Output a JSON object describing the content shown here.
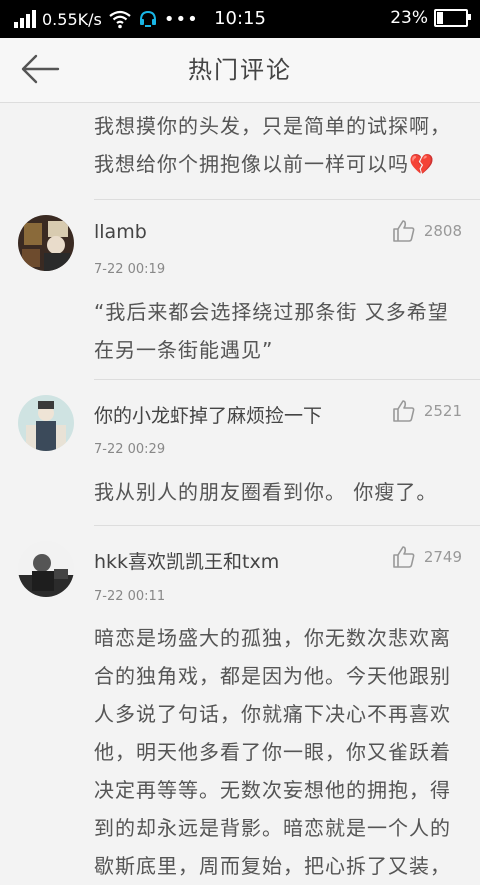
{
  "status_bar": {
    "network_speed": "0.55K/s",
    "time": "10:15",
    "battery": "23%",
    "battery_level": 0.23
  },
  "header": {
    "title": "热门评论",
    "back_icon": "back-arrow-icon"
  },
  "top_text": "我想摸你的头发，只是简单的试探啊，我想给你个拥抱像以前一样可以吗💔",
  "comments": [
    {
      "name": "llamb",
      "likes": "2808",
      "time": "7-22 00:19",
      "text": "“我后来都会选择绕过那条街 又多希望在另一条街能遇见”"
    },
    {
      "name": "你的小龙虾掉了麻烦捡一下",
      "likes": "2521",
      "time": "7-22 00:29",
      "text": "我从别人的朋友圈看到你。 你瘦了。"
    },
    {
      "name": "hkk喜欢凯凯王和txm",
      "likes": "2749",
      "time": "7-22 00:11",
      "text": "暗恋是场盛大的孤独，你无数次悲欢离合的独角戏，都是因为他。今天他跟别人多说了句话，你就痛下决心不再喜欢他，明天他多看了你一眼，你又雀跃着决定再等等。无数次妄想他的拥抱，得到的却永远是背影。暗恋就是一个人的歇斯底里，周而复始，把心拆了又装，"
    }
  ],
  "colors": {
    "status_bar": "#000000",
    "background": "#f3f3f3",
    "text": "#555555",
    "meta": "#888888"
  }
}
